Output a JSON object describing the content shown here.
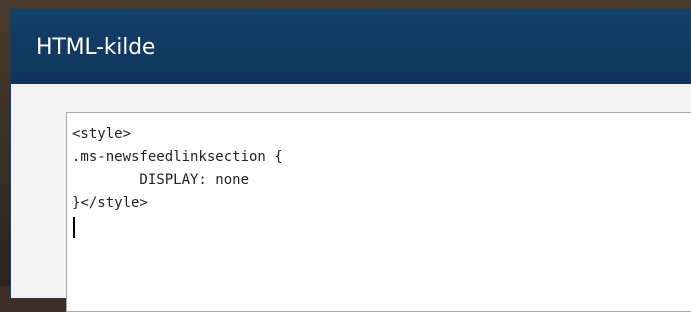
{
  "dialog": {
    "title": "HTML-kilde"
  },
  "editor": {
    "lines": [
      "<style>",
      ".ms-newsfeedlinksection {",
      "        DISPLAY: none",
      "}</style>",
      ""
    ]
  },
  "colors": {
    "title_bar": "#0d355c",
    "title_text": "#ffffff",
    "editor_background": "#ffffff",
    "dialog_background": "#f3f3f3"
  }
}
